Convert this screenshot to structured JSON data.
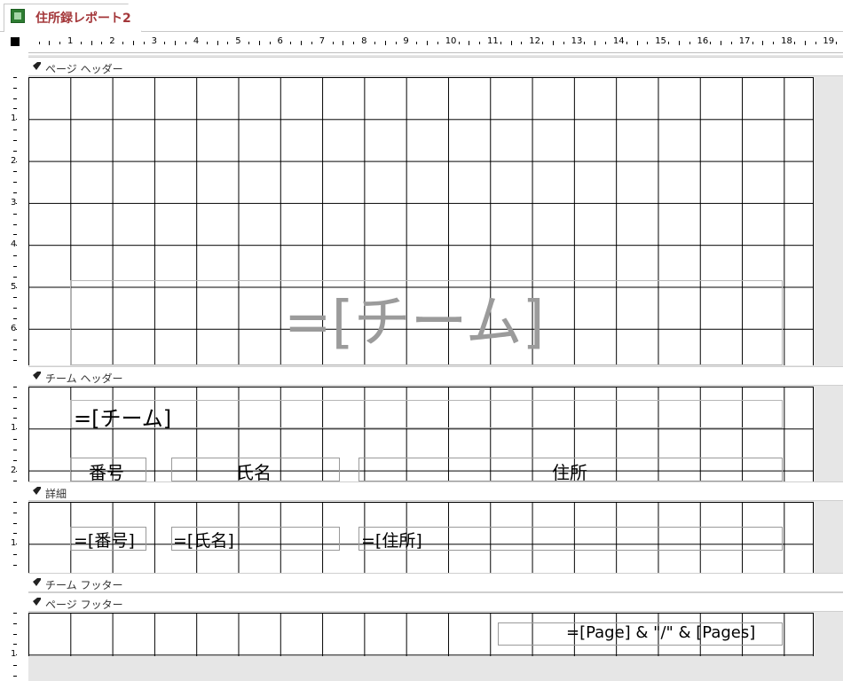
{
  "document": {
    "tab_title": "住所録レポート2"
  },
  "ruler": {
    "top_numbers": [
      "1",
      "2",
      "3",
      "4",
      "5",
      "6",
      "7",
      "8",
      "9",
      "10",
      "11",
      "12",
      "13",
      "14",
      "15",
      "16",
      "17",
      "18",
      "19"
    ],
    "page_header_numbers": [
      "1",
      "2",
      "3",
      "4",
      "5",
      "6"
    ],
    "team_header_numbers": [
      "1",
      "2"
    ],
    "detail_numbers": [
      "1"
    ],
    "page_footer_numbers": [
      "1"
    ]
  },
  "sections": {
    "page_header": "ページ ヘッダー",
    "team_header": "チーム ヘッダー",
    "detail": "詳細",
    "team_footer": "チーム フッター",
    "page_footer": "ページ フッター"
  },
  "controls": {
    "page_header_team": "=[チーム]",
    "team_header_team": "=[チーム]",
    "label_number": "番号",
    "label_name": "氏名",
    "label_address": "住所",
    "field_number": "=[番号]",
    "field_name": "=[氏名]",
    "field_address": "=[住所]",
    "page_expression": "=[Page] & \"/\" & [Pages]"
  }
}
